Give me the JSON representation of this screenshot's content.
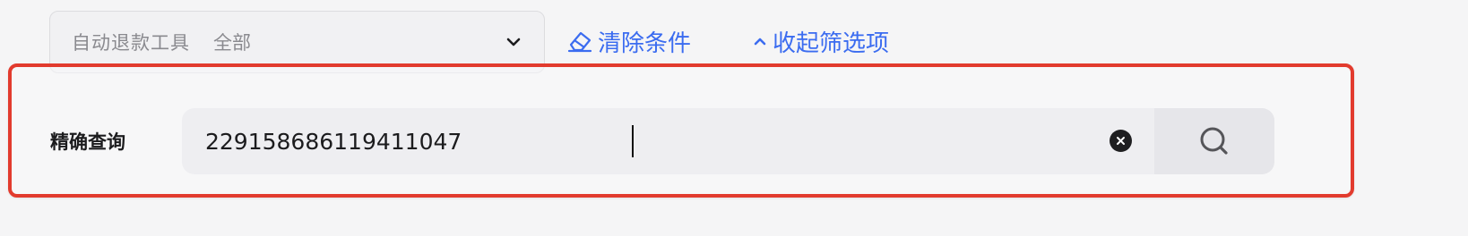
{
  "filter": {
    "label": "自动退款工具",
    "value": "全部",
    "chevron_icon": "chevron-down-icon"
  },
  "actions": {
    "clear_label": "清除条件",
    "clear_icon": "eraser-icon",
    "collapse_label": "收起筛选项",
    "collapse_icon": "chevron-up-icon",
    "link_color": "#3b6cf0"
  },
  "query": {
    "label": "精确查询",
    "value": "229158686119411047",
    "clear_icon": "clear-circle-icon",
    "search_icon": "search-icon"
  },
  "highlight_color": "#e23b2e"
}
